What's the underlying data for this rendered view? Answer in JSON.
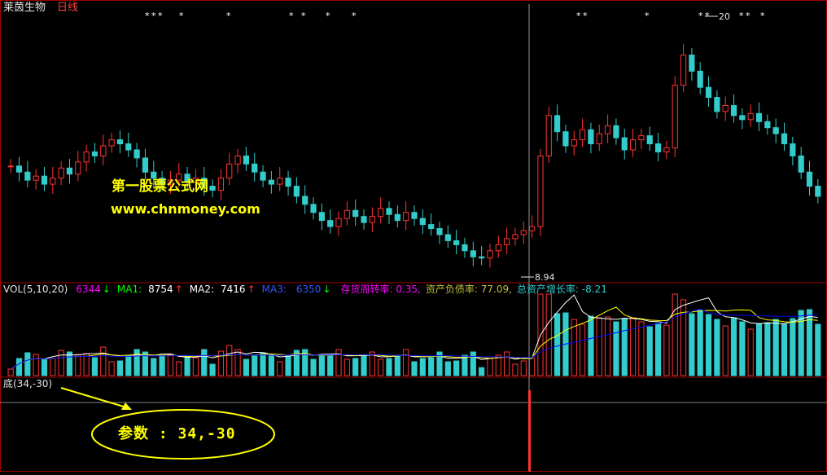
{
  "header": {
    "stock_name": "莱茵生物",
    "period": "日线"
  },
  "volume_panel": {
    "title": "VOL(5,10,20)",
    "vol_value": "6344",
    "vol_arrow": "↓",
    "ma1_label": "MA1:",
    "ma1_value": "8754",
    "ma1_arrow": "↑",
    "ma2_label": "MA2:",
    "ma2_value": "7416",
    "ma2_arrow": "↑",
    "ma3_label": "MA3:",
    "ma3_value": "6350",
    "ma3_arrow": "↓",
    "inventory_turnover": "存货周转率: 0.35,",
    "debt_ratio": "资产负债率: 77.09,",
    "asset_growth": "总资产增长率: -8.21"
  },
  "indicator_panel": {
    "title": "底(34,-30)"
  },
  "annotations": {
    "watermark_cn": "第一股票公式网",
    "watermark_url": "www.chnmoney.com",
    "params_callout": "参数 : 34,-30",
    "low_price": "8.94",
    "high_price": "20"
  },
  "colors": {
    "up": "#ff3333",
    "down": "#33cccc",
    "grid": "#a00000",
    "ma1": "#ffffff",
    "ma2": "#ffff00",
    "ma3": "#0000ff",
    "vol_label": "#ff00ff",
    "callout": "#ffff00"
  },
  "chart_data": {
    "type": "candlestick",
    "title": "莱茵生物 日线",
    "lows_annotated": {
      "low": 8.94,
      "high": 20
    },
    "closes": [
      13.5,
      13.2,
      12.8,
      13.0,
      12.6,
      12.9,
      13.4,
      13.1,
      13.7,
      14.2,
      14.0,
      14.5,
      14.8,
      14.6,
      14.3,
      13.9,
      13.2,
      12.9,
      12.6,
      12.8,
      13.1,
      12.7,
      12.9,
      12.5,
      12.3,
      12.9,
      13.6,
      14.0,
      13.6,
      13.2,
      12.8,
      12.6,
      12.9,
      12.5,
      12.0,
      11.6,
      11.2,
      10.8,
      10.5,
      10.9,
      11.3,
      11.0,
      10.7,
      11.0,
      11.4,
      11.1,
      10.8,
      11.2,
      10.9,
      10.6,
      10.4,
      10.1,
      9.8,
      9.6,
      9.3,
      9.0,
      8.94,
      9.3,
      9.6,
      9.9,
      10.1,
      10.3,
      10.5,
      14.0,
      16.0,
      15.2,
      14.5,
      14.8,
      15.3,
      14.6,
      15.1,
      15.5,
      14.9,
      14.3,
      14.8,
      15.0,
      14.6,
      14.2,
      14.4,
      17.5,
      19.0,
      18.2,
      17.4,
      16.9,
      16.2,
      16.5,
      16.0,
      15.8,
      16.1,
      15.7,
      15.4,
      15.1,
      14.6,
      14.0,
      13.2,
      12.5,
      12.0
    ]
  }
}
